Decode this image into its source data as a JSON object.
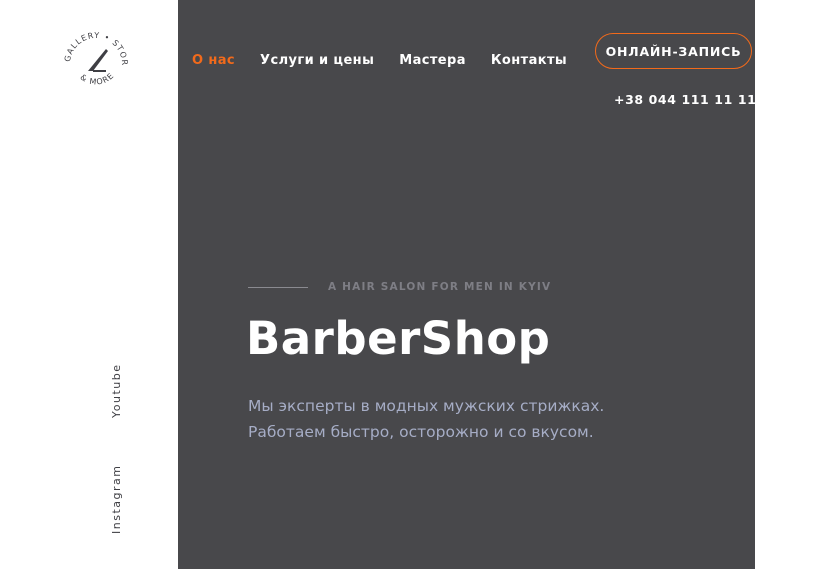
{
  "logo": {
    "text_top": "GALLERY • STORE",
    "text_bottom": "& MORE",
    "icon": "razor-icon"
  },
  "social": {
    "youtube": "Youtube",
    "instagram": "Instagram"
  },
  "nav": {
    "items": [
      {
        "label": "О нас",
        "active": true
      },
      {
        "label": "Услуги и цены",
        "active": false
      },
      {
        "label": "Мастера",
        "active": false
      },
      {
        "label": "Контакты",
        "active": false
      }
    ]
  },
  "header": {
    "cta_label": "ОНЛАЙН-ЗАПИСЬ",
    "phone": "+38 044 111 11 11"
  },
  "hero": {
    "eyebrow": "A HAIR SALON FOR MEN IN KYIV",
    "title": "BarberShop",
    "lead_line1": "Мы эксперты в модных мужских стрижках.",
    "lead_line2": "Работаем быстро, осторожно и со вкусом."
  },
  "colors": {
    "accent": "#f26a1b",
    "hero_bg": "#48484b",
    "lead_text": "#a6adc6"
  }
}
